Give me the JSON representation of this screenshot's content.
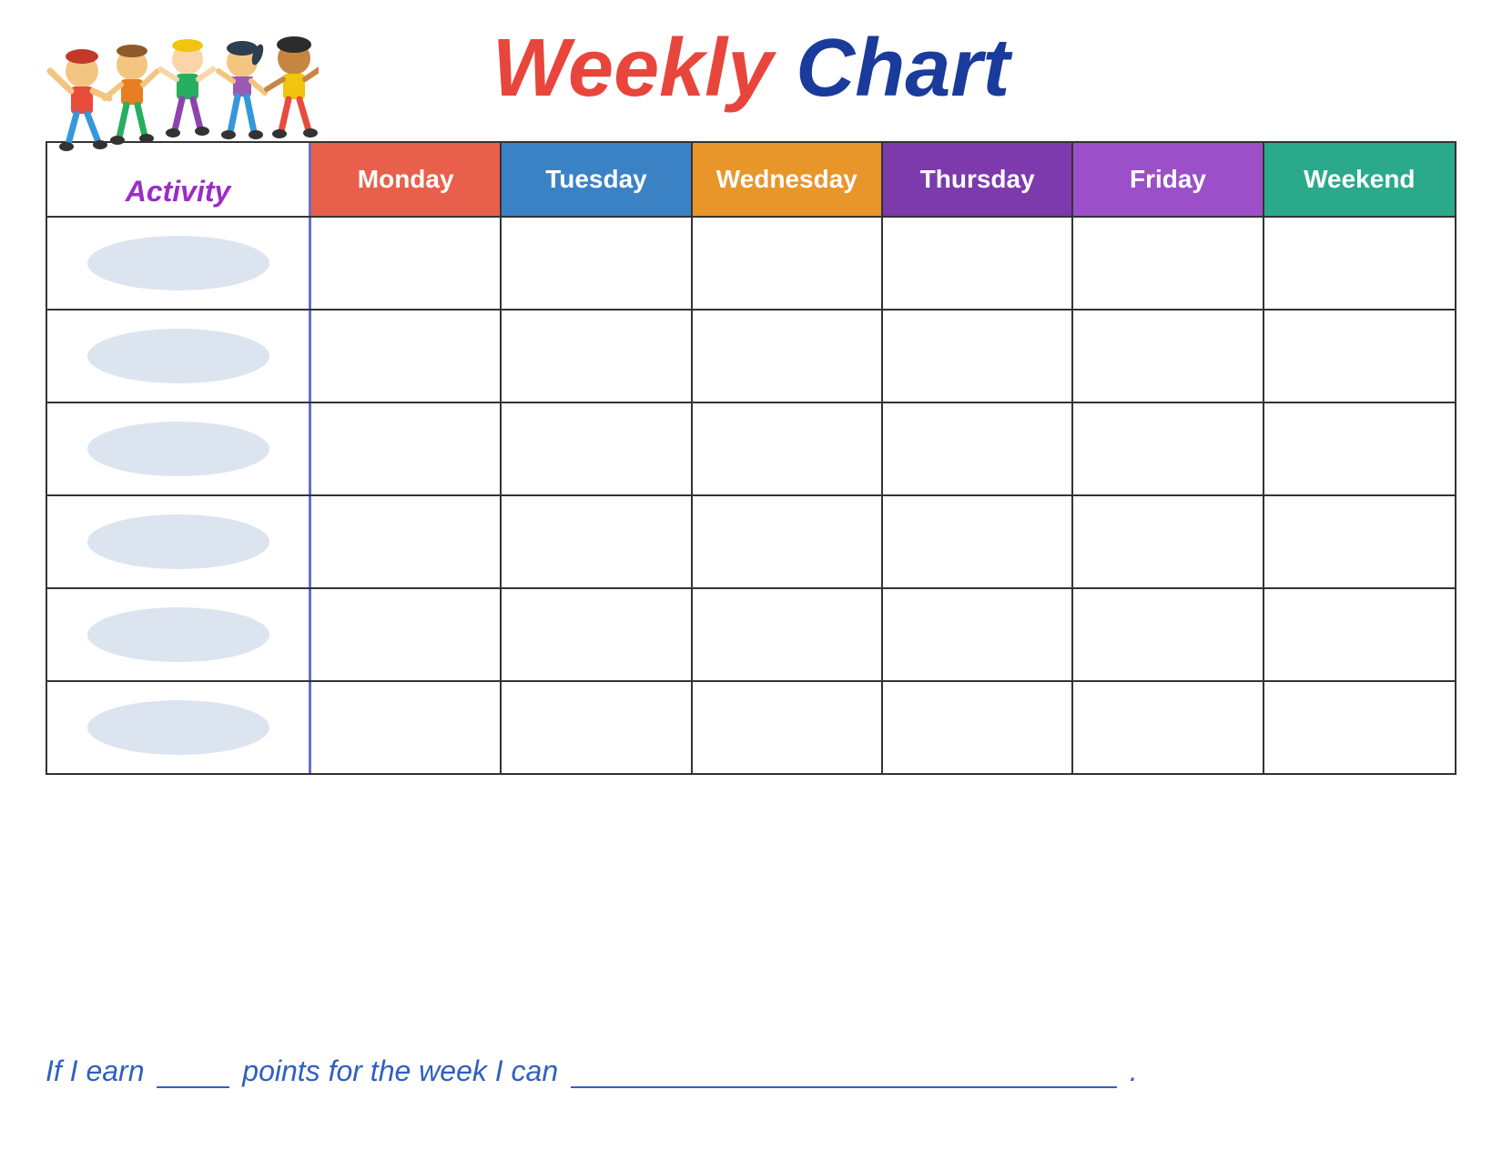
{
  "title": {
    "weekly": "Weekly",
    "chart": "Chart"
  },
  "header": {
    "activity": "Activity",
    "days": [
      "Monday",
      "Tuesday",
      "Wednesday",
      "Thursday",
      "Friday",
      "Weekend"
    ]
  },
  "rows": [
    {
      "id": 1
    },
    {
      "id": 2
    },
    {
      "id": 3
    },
    {
      "id": 4
    },
    {
      "id": 5
    },
    {
      "id": 6
    }
  ],
  "footer": {
    "text_part1": "If I earn",
    "text_part2": "points for the week I can",
    "text_end": "."
  },
  "colors": {
    "monday": "#e8604c",
    "tuesday": "#3b82c4",
    "wednesday": "#e8952a",
    "thursday": "#7c3aad",
    "friday": "#9b4fc8",
    "weekend": "#2aaa8a"
  }
}
